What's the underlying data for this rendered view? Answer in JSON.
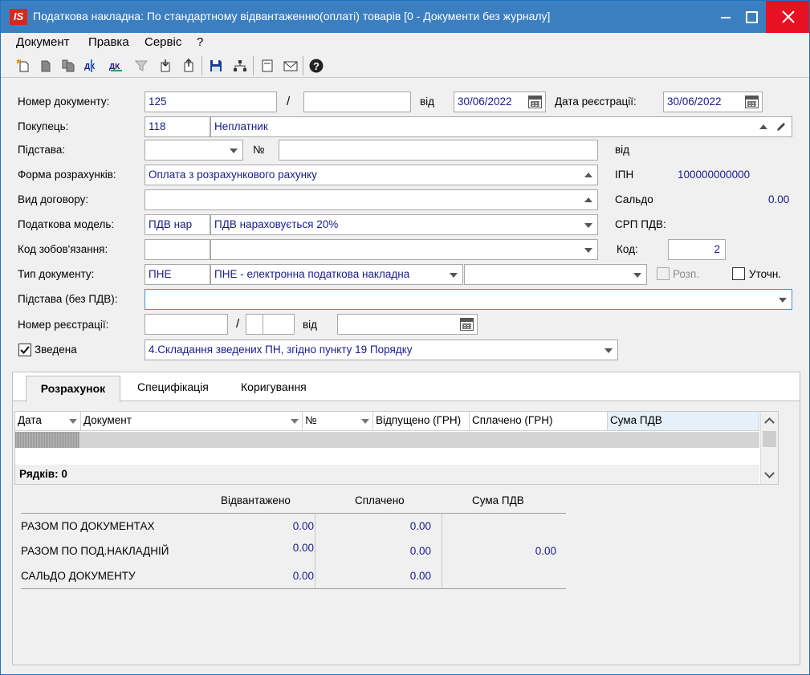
{
  "window": {
    "logo": "IS",
    "title": "Податкова накладна: По стандартному відвантаженню(оплаті) товарів [0 - Документи без журналу]"
  },
  "menu": [
    "Документ",
    "Правка",
    "Сервіс",
    "?"
  ],
  "toolbar": {
    "icons": [
      "new-doc-icon",
      "copy-doc-icon",
      "copy-doc2-icon",
      "dk-icon",
      "dk2-icon",
      "filter-icon",
      "import-icon",
      "export-icon",
      "save-icon",
      "tree-icon",
      "form-icon",
      "mail-icon",
      "help-icon"
    ],
    "dk_label": "ДК"
  },
  "form": {
    "doc_number": {
      "label": "Номер документу:",
      "value": "125",
      "slash": "/",
      "suffix": ""
    },
    "from_label": "від",
    "doc_date": "30/06/2022",
    "reg_date": {
      "label": "Дата реєстрації:",
      "value": "30/06/2022"
    },
    "buyer": {
      "label": "Покупець:",
      "code": "118",
      "name": "Неплатник"
    },
    "basis": {
      "label": "Підстава:",
      "value": "",
      "no_label": "№",
      "no_value": "",
      "from_label": "від"
    },
    "payment_form": {
      "label": "Форма розрахунків:",
      "value": "Оплата з розрахункового рахунку"
    },
    "ipn": {
      "label": "ІПН",
      "value": "100000000000"
    },
    "contract_type": {
      "label": "Вид договору:",
      "value": ""
    },
    "saldo": {
      "label": "Сальдо",
      "value": "0.00"
    },
    "tax_model": {
      "label": "Податкова модель:",
      "code": "ПДВ нар",
      "name": "ПДВ нараховується 20%"
    },
    "srp": {
      "label": "СРП ПДВ:"
    },
    "obligation": {
      "label": "Код зобов'язання:",
      "code": "",
      "name": ""
    },
    "kod": {
      "label": "Код:",
      "value": "2"
    },
    "doc_type": {
      "label": "Тип документу:",
      "code": "ПНЕ",
      "name": "ПНЕ - електронна податкова накладна",
      "extra": ""
    },
    "rozp": {
      "label": "Розп.",
      "checked": false
    },
    "utoch": {
      "label": "Уточн.",
      "checked": false
    },
    "basis_no_vat": {
      "label": "Підстава (без ПДВ):",
      "value": ""
    },
    "reg_number": {
      "label": "Номер реєстрації:",
      "value": "",
      "slash": "/",
      "part2": "",
      "part3": "",
      "from_label": "від",
      "date": ""
    },
    "zvedena": {
      "label": "Зведена",
      "checked": true,
      "value": "4.Складання зведених ПН, згідно пункту 19  Порядку"
    }
  },
  "tabs": [
    "Розрахунок",
    "Специфікація",
    "Коригування"
  ],
  "grid": {
    "columns": [
      "Дата",
      "Документ",
      "№",
      "Відпущено (ГРН)",
      "Сплачено (ГРН)",
      "Сума ПДВ"
    ],
    "rows_label": "Рядків: 0"
  },
  "totals": {
    "headers": [
      "Відвантажено",
      "Сплачено",
      "Сума ПДВ"
    ],
    "rows": [
      {
        "label": "РАЗОМ ПО ДОКУМЕНТАХ",
        "shipped": "0.00",
        "paid": "0.00",
        "vat": ""
      },
      {
        "label": "РАЗОМ ПО ПОД.НАКЛАДНІЙ",
        "shipped": "0.00",
        "paid": "0.00",
        "vat": "0.00"
      },
      {
        "label": "САЛЬДО ДОКУМЕНТУ",
        "shipped": "0.00",
        "paid": "0.00",
        "vat": ""
      }
    ]
  }
}
